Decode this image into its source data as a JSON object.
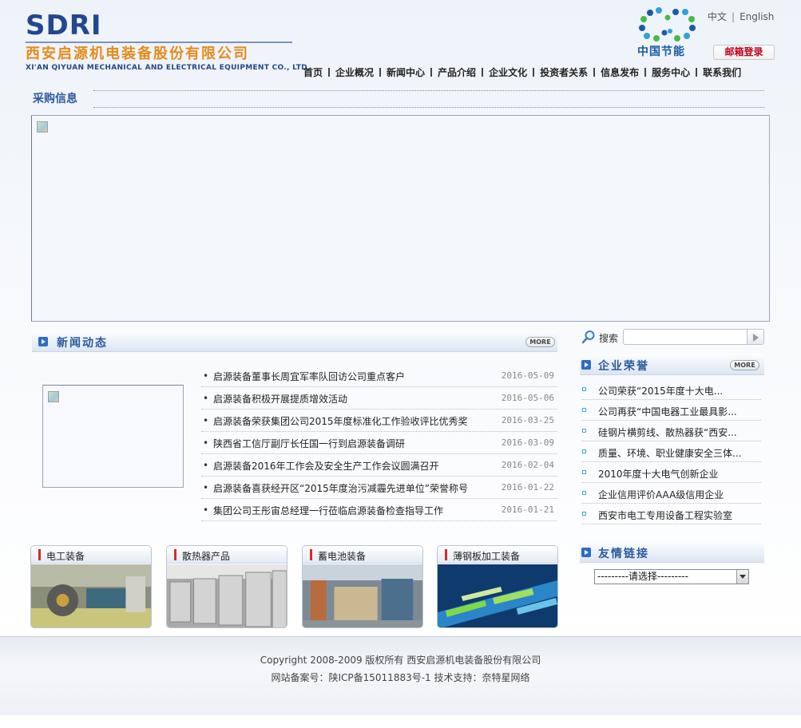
{
  "header": {
    "logo_brand": "SDRI",
    "logo_company_cn": "西安启源机电装备股份有限公司",
    "logo_company_en": "XI'AN QIYUAN MECHANICAL AND ELECTRICAL EQUIPMENT CO., LTD.",
    "energy_logo_text": "中国节能",
    "lang_cn": "中文",
    "lang_en": "English",
    "mail_login": "邮箱登录"
  },
  "nav": {
    "items": [
      "首页",
      "企业概况",
      "新闻中心",
      "产品介绍",
      "企业文化",
      "投资者关系",
      "信息发布",
      "服务中心",
      "联系我们"
    ]
  },
  "procurement": {
    "title": "采购信息"
  },
  "news": {
    "title": "新闻动态",
    "more": "MORE",
    "items": [
      {
        "title": "启源装备董事长周宜军率队回访公司重点客户",
        "date": "2016-05-09"
      },
      {
        "title": "启源装备积极开展提质增效活动",
        "date": "2016-05-06"
      },
      {
        "title": "启源装备荣获集团公司2015年度标准化工作验收评比优秀奖",
        "date": "2016-03-25"
      },
      {
        "title": "陕西省工信厅副厅长任国一行到启源装备调研",
        "date": "2016-03-09"
      },
      {
        "title": "启源装备2016年工作会及安全生产工作会议圆满召开",
        "date": "2016-02-04"
      },
      {
        "title": "启源装备喜获经开区“2015年度治污减霾先进单位”荣誉称号",
        "date": "2016-01-22"
      },
      {
        "title": "集团公司王彤宙总经理一行莅临启源装备检查指导工作",
        "date": "2016-01-21"
      }
    ]
  },
  "search": {
    "label": "搜索",
    "placeholder": ""
  },
  "honors": {
    "title": "企业荣誉",
    "more": "MORE",
    "items": [
      "公司荣获“2015年度十大电...",
      "公司再获“中国电器工业最具影...",
      "硅钢片横剪线、散热器获“西安...",
      "质量、环境、职业健康安全三体...",
      "2010年度十大电气创新企业",
      "企业信用评价AAA级信用企业",
      "西安市电工专用设备工程实验室"
    ]
  },
  "links": {
    "title": "友情链接",
    "select_value": "---------请选择---------"
  },
  "products": [
    {
      "label": "电工装备"
    },
    {
      "label": "散热器产品"
    },
    {
      "label": "蓄电池装备"
    },
    {
      "label": "薄钢板加工装备"
    }
  ],
  "footer": {
    "copyright": "Copyright 2008-2009 版权所有 西安启源机电装备股份有限公司",
    "icp": "网站备案号：陕ICP备15011883号-1 技术支持：奈特星网络"
  }
}
